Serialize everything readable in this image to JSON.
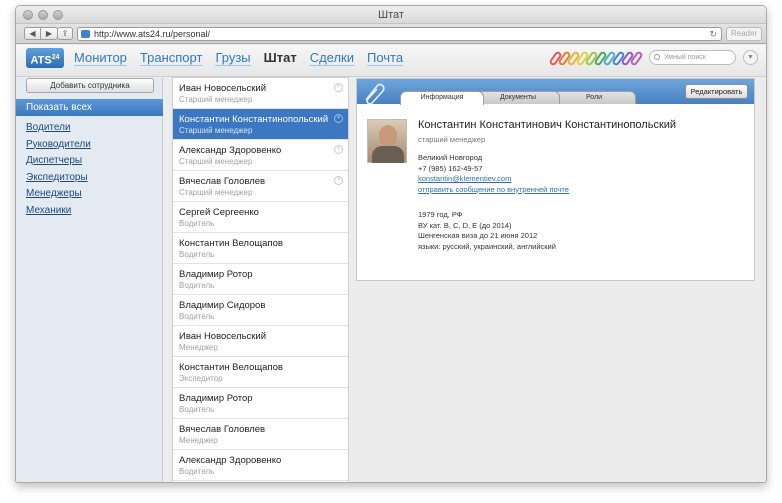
{
  "browser": {
    "title": "Штат",
    "url": "http://www.ats24.ru/personal/",
    "reader_label": "Reader",
    "back_glyph": "◀",
    "forward_glyph": "▶",
    "share_glyph": "⇪",
    "reload_glyph": "↻"
  },
  "app": {
    "logo_text": "ATS",
    "logo_sup": "24",
    "nav": [
      "Монитор",
      "Транспорт",
      "Грузы",
      "Штат",
      "Сделки",
      "Почта"
    ],
    "active_nav": "Штат",
    "search_placeholder": "Умный поиск",
    "menu_glyph": "▼",
    "clip_colors": [
      "#e05a5a",
      "#e87a3a",
      "#e8b53a",
      "#e0d040",
      "#9bc74a",
      "#4aa85a",
      "#4ab0c0",
      "#4a82d0",
      "#8a5ad0",
      "#c05ab0"
    ]
  },
  "sidebar": {
    "add_button": "Добавить сотрудника",
    "show_all": "Показать всех",
    "categories": [
      "Водители",
      "Руководители",
      "Диспетчеры",
      "Экспедиторы",
      "Менеджеры",
      "Механики"
    ]
  },
  "people": [
    {
      "name": "Иван Новосельский",
      "role": "Старший менеджер"
    },
    {
      "name": "Константин Константинопольский",
      "role": "Старший менеджер"
    },
    {
      "name": "Александр Здоровенко",
      "role": "Старший менеджер"
    },
    {
      "name": "Вячеслав Головлев",
      "role": "Старший менеджер"
    },
    {
      "name": "Сергей Сергеенко",
      "role": "Водитель"
    },
    {
      "name": "Константин Велощапов",
      "role": "Водитель"
    },
    {
      "name": "Владимир Ротор",
      "role": "Водитель"
    },
    {
      "name": "Владимир Сидоров",
      "role": "Водитель"
    },
    {
      "name": "Иван Новосельский",
      "role": "Менеджер"
    },
    {
      "name": "Константин Велощапов",
      "role": "Экспедитор"
    },
    {
      "name": "Владимир Ротор",
      "role": "Водитель"
    },
    {
      "name": "Вячеслав Головлев",
      "role": "Менеджер"
    },
    {
      "name": "Александр Здоровенко",
      "role": "Водитель"
    }
  ],
  "remove_glyph": "×",
  "card": {
    "tabs": [
      "Информация",
      "Документы",
      "Роли"
    ],
    "active_tab": "Информация",
    "edit_button": "Редактировать",
    "full_name": "Константин Константинович Константинопольский",
    "position": "старший менеджер",
    "city": "Великий Новгород",
    "phone": "+7 (985) 162-49-57",
    "email": "konstantin@klementiev.com",
    "internal_mail_link": "отправить сообщение по внутренней почте",
    "birth": "1979 год, РФ",
    "license": "ВУ кат. B, C, D, E (до 2014)",
    "visa": "Шенгенская виза до 21 июня 2012",
    "languages": "языки: русский, украинский, английский"
  }
}
